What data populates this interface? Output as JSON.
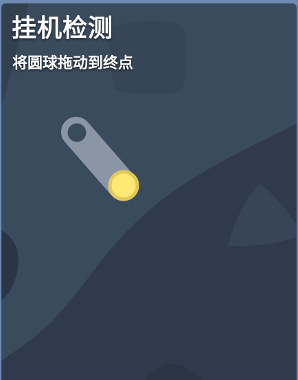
{
  "dialog": {
    "title": "挂机检测",
    "instruction": "将圆球拖动到终点"
  },
  "colors": {
    "outer_background": "#6e8ab3",
    "card_background": "#3b4b5e",
    "dark_shape": "#2f3b4c",
    "track": "#8a96a6",
    "endpoint_ring": "#3b4b5e",
    "ball_fill": "#ffe873",
    "ball_border": "#e2c75a",
    "text": "#ffffff"
  },
  "icons": {
    "ball": "yellow-circle",
    "target": "hollow-circle"
  }
}
